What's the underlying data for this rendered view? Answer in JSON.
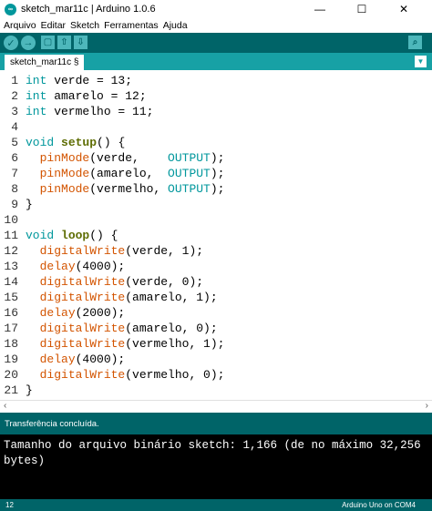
{
  "window": {
    "title": "sketch_mar11c | Arduino 1.0.6",
    "logo_text": "∞",
    "controls": {
      "minimize": "—",
      "maximize": "☐",
      "close": "✕"
    }
  },
  "menu": [
    "Arquivo",
    "Editar",
    "Sketch",
    "Ferramentas",
    "Ajuda"
  ],
  "toolbar": {
    "verify_icon": "✓",
    "upload_icon": "→",
    "new_icon": "▢",
    "open_icon": "⇧",
    "save_icon": "⇩",
    "serial_icon": "⌕"
  },
  "tab": {
    "label": "sketch_mar11c §",
    "menu_icon": "▼"
  },
  "code": [
    [
      {
        "t": "int",
        "c": "kw-type"
      },
      {
        "t": " verde = 13;"
      }
    ],
    [
      {
        "t": "int",
        "c": "kw-type"
      },
      {
        "t": " amarelo = 12;"
      }
    ],
    [
      {
        "t": "int",
        "c": "kw-type"
      },
      {
        "t": " vermelho = 11;"
      }
    ],
    [],
    [
      {
        "t": "void",
        "c": "kw-type"
      },
      {
        "t": " "
      },
      {
        "t": "setup",
        "c": "kw-fn"
      },
      {
        "t": "() {"
      }
    ],
    [
      {
        "t": "  "
      },
      {
        "t": "pinMode",
        "c": "kw-call"
      },
      {
        "t": "(verde,    "
      },
      {
        "t": "OUTPUT",
        "c": "kw-const"
      },
      {
        "t": ");"
      }
    ],
    [
      {
        "t": "  "
      },
      {
        "t": "pinMode",
        "c": "kw-call"
      },
      {
        "t": "(amarelo,  "
      },
      {
        "t": "OUTPUT",
        "c": "kw-const"
      },
      {
        "t": ");"
      }
    ],
    [
      {
        "t": "  "
      },
      {
        "t": "pinMode",
        "c": "kw-call"
      },
      {
        "t": "(vermelho, "
      },
      {
        "t": "OUTPUT",
        "c": "kw-const"
      },
      {
        "t": ");"
      }
    ],
    [
      {
        "t": "}"
      }
    ],
    [],
    [
      {
        "t": "void",
        "c": "kw-type"
      },
      {
        "t": " "
      },
      {
        "t": "loop",
        "c": "kw-fn"
      },
      {
        "t": "() {"
      }
    ],
    [
      {
        "t": "  "
      },
      {
        "t": "digitalWrite",
        "c": "kw-call"
      },
      {
        "t": "(verde, 1);"
      }
    ],
    [
      {
        "t": "  "
      },
      {
        "t": "delay",
        "c": "kw-call"
      },
      {
        "t": "(4000);"
      }
    ],
    [
      {
        "t": "  "
      },
      {
        "t": "digitalWrite",
        "c": "kw-call"
      },
      {
        "t": "(verde, 0);"
      }
    ],
    [
      {
        "t": "  "
      },
      {
        "t": "digitalWrite",
        "c": "kw-call"
      },
      {
        "t": "(amarelo, 1);"
      }
    ],
    [
      {
        "t": "  "
      },
      {
        "t": "delay",
        "c": "kw-call"
      },
      {
        "t": "(2000);"
      }
    ],
    [
      {
        "t": "  "
      },
      {
        "t": "digitalWrite",
        "c": "kw-call"
      },
      {
        "t": "(amarelo, 0);"
      }
    ],
    [
      {
        "t": "  "
      },
      {
        "t": "digitalWrite",
        "c": "kw-call"
      },
      {
        "t": "(vermelho, 1);"
      }
    ],
    [
      {
        "t": "  "
      },
      {
        "t": "delay",
        "c": "kw-call"
      },
      {
        "t": "(4000);"
      }
    ],
    [
      {
        "t": "  "
      },
      {
        "t": "digitalWrite",
        "c": "kw-call"
      },
      {
        "t": "(vermelho, 0);"
      }
    ],
    [
      {
        "t": "}"
      }
    ]
  ],
  "scroll": {
    "left_icon": "‹",
    "right_icon": "›"
  },
  "status": "Transferência concluída.",
  "console": [
    "Tamanho do arquivo binário sketch: 1,166 (de no máximo 32,256",
    "bytes)"
  ],
  "footer": {
    "line_number": "12",
    "board": "Arduino Uno on COM4"
  },
  "colors": {
    "toolbar": "#006468",
    "tabbar": "#17a1a5",
    "button": "#4db7bb",
    "keyword": "#00979c",
    "function_name": "#5e6d03",
    "builtin_call": "#d35400"
  }
}
